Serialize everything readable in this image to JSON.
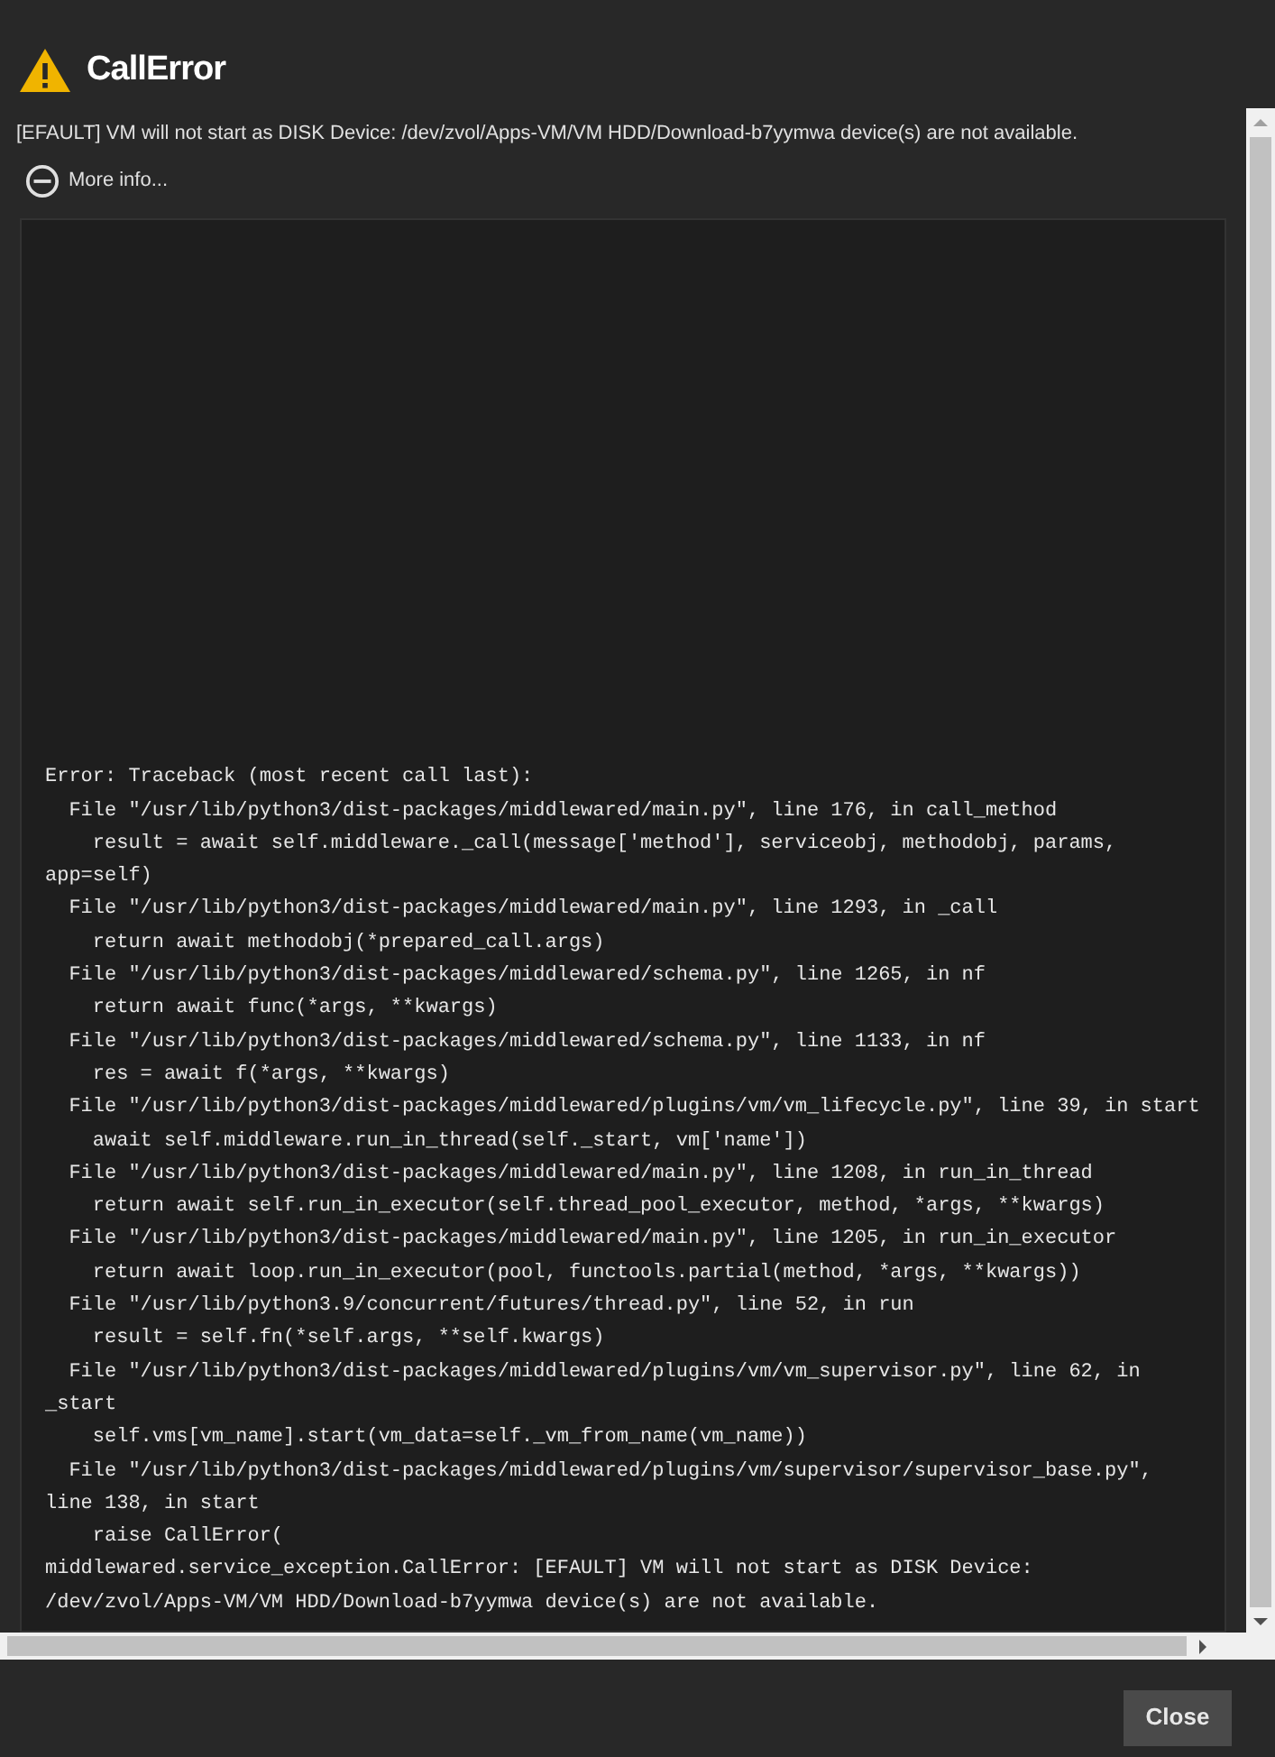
{
  "dialog": {
    "title": "CallError",
    "message": "[EFAULT] VM will not start as DISK Device: /dev/zvol/Apps-VM/VM HDD/Download-b7yymwa device(s) are not available.",
    "more_info": {
      "label": "More info...",
      "expanded": true
    },
    "trace_lines": [
      "Error: Traceback (most recent call last):",
      "  File \"/usr/lib/python3/dist-packages/middlewared/main.py\", line 176, in call_method",
      "    result = await self.middleware._call(message['method'], serviceobj, methodobj, params,",
      "app=self)",
      "  File \"/usr/lib/python3/dist-packages/middlewared/main.py\", line 1293, in _call",
      "    return await methodobj(*prepared_call.args)",
      "  File \"/usr/lib/python3/dist-packages/middlewared/schema.py\", line 1265, in nf",
      "    return await func(*args, **kwargs)",
      "  File \"/usr/lib/python3/dist-packages/middlewared/schema.py\", line 1133, in nf",
      "    res = await f(*args, **kwargs)",
      "  File \"/usr/lib/python3/dist-packages/middlewared/plugins/vm/vm_lifecycle.py\", line 39, in start",
      "    await self.middleware.run_in_thread(self._start, vm['name'])",
      "  File \"/usr/lib/python3/dist-packages/middlewared/main.py\", line 1208, in run_in_thread",
      "    return await self.run_in_executor(self.thread_pool_executor, method, *args, **kwargs)",
      "  File \"/usr/lib/python3/dist-packages/middlewared/main.py\", line 1205, in run_in_executor",
      "    return await loop.run_in_executor(pool, functools.partial(method, *args, **kwargs))",
      "  File \"/usr/lib/python3.9/concurrent/futures/thread.py\", line 52, in run",
      "    result = self.fn(*self.args, **self.kwargs)",
      "  File \"/usr/lib/python3/dist-packages/middlewared/plugins/vm/vm_supervisor.py\", line 62, in",
      "_start",
      "    self.vms[vm_name].start(vm_data=self._vm_from_name(vm_name))",
      "  File \"/usr/lib/python3/dist-packages/middlewared/plugins/vm/supervisor/supervisor_base.py\",",
      "line 138, in start",
      "    raise CallError(",
      "middlewared.service_exception.CallError: [EFAULT] VM will not start as DISK Device:",
      "/dev/zvol/Apps-VM/VM HDD/Download-b7yymwa device(s) are not available."
    ],
    "buttons": [
      {
        "label": "Close"
      }
    ]
  }
}
